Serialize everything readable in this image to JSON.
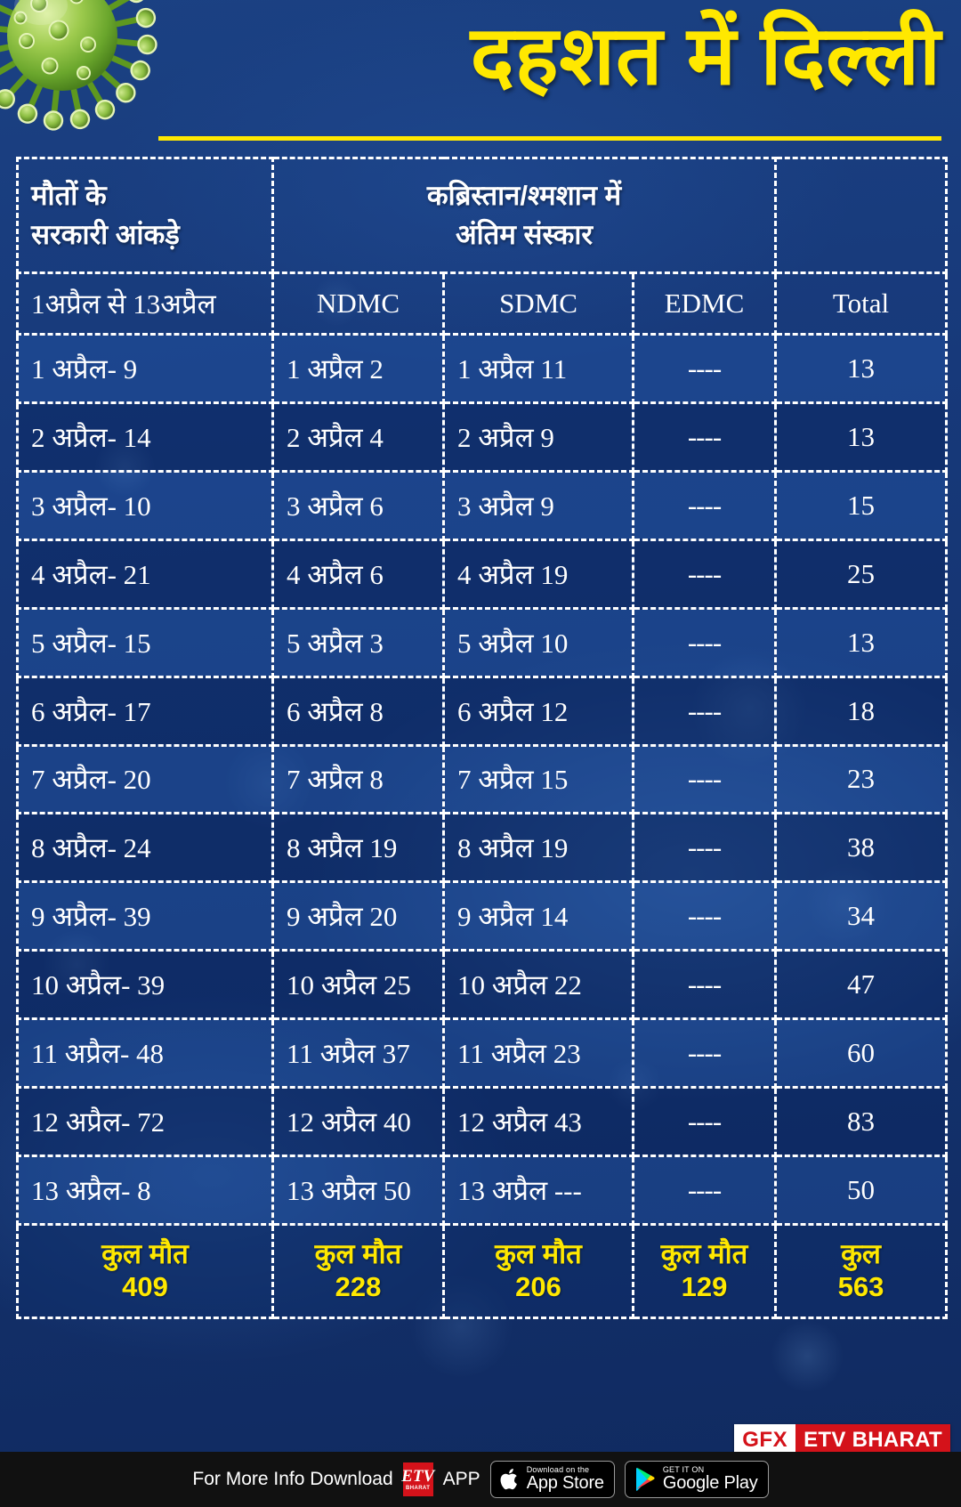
{
  "title": "दहशत में दिल्ली",
  "colors": {
    "accent_yellow": "#ffe800",
    "background_blue": "#16377a",
    "brand_red": "#d4121a",
    "footer_black": "#111111",
    "text_white": "#ffffff"
  },
  "table": {
    "header_groups": [
      {
        "label": "मौतों के\nसरकारी आंकड़े",
        "span": 1
      },
      {
        "label": "कब्रिस्तान/श्मशान में\nअंतिम संस्कार",
        "span": 3
      },
      {
        "label": "",
        "span": 1
      }
    ],
    "header_group_left_line1": "मौतों के",
    "header_group_left_line2": "सरकारी आंकड़े",
    "header_group_mid_line1": "कब्रिस्तान/श्मशान में",
    "header_group_mid_line2": "अंतिम संस्कार",
    "columns": [
      "1अप्रैल से 13अप्रैल",
      "NDMC",
      "SDMC",
      "EDMC",
      "Total"
    ],
    "rows": [
      {
        "govt": "1 अप्रैल- 9",
        "ndmc": "1 अप्रैल 2",
        "sdmc": "1 अप्रैल  11",
        "edmc": "----",
        "total": "13"
      },
      {
        "govt": "2 अप्रैल- 14",
        "ndmc": "2 अप्रैल 4",
        "sdmc": "2 अप्रैल  9",
        "edmc": "----",
        "total": "13"
      },
      {
        "govt": "3 अप्रैल- 10",
        "ndmc": "3 अप्रैल 6",
        "sdmc": "3 अप्रैल  9",
        "edmc": "----",
        "total": "15"
      },
      {
        "govt": "4 अप्रैल- 21",
        "ndmc": "4 अप्रैल 6",
        "sdmc": "4 अप्रैल  19",
        "edmc": "----",
        "total": "25"
      },
      {
        "govt": "5 अप्रैल- 15",
        "ndmc": "5 अप्रैल 3",
        "sdmc": "5 अप्रैल  10",
        "edmc": "----",
        "total": "13"
      },
      {
        "govt": "6 अप्रैल- 17",
        "ndmc": "6 अप्रैल 8",
        "sdmc": "6 अप्रैल  12",
        "edmc": "----",
        "total": "18"
      },
      {
        "govt": "7 अप्रैल- 20",
        "ndmc": "7 अप्रैल 8",
        "sdmc": "7 अप्रैल  15",
        "edmc": "----",
        "total": "23"
      },
      {
        "govt": "8 अप्रैल- 24",
        "ndmc": "8 अप्रैल 19",
        "sdmc": "8 अप्रैल  19",
        "edmc": "----",
        "total": "38"
      },
      {
        "govt": "9 अप्रैल- 39",
        "ndmc": "9 अप्रैल 20",
        "sdmc": "9 अप्रैल  14",
        "edmc": "----",
        "total": "34"
      },
      {
        "govt": "10 अप्रैल- 39",
        "ndmc": "10 अप्रैल 25",
        "sdmc": "10 अप्रैल  22",
        "edmc": "----",
        "total": "47"
      },
      {
        "govt": "11 अप्रैल- 48",
        "ndmc": "11 अप्रैल 37",
        "sdmc": "11 अप्रैल  23",
        "edmc": "----",
        "total": "60"
      },
      {
        "govt": "12 अप्रैल- 72",
        "ndmc": "12 अप्रैल 40",
        "sdmc": "12 अप्रैल  43",
        "edmc": "----",
        "total": "83"
      },
      {
        "govt": "13 अप्रैल- 8",
        "ndmc": "13 अप्रैल 50",
        "sdmc": "13 अप्रैल ---",
        "edmc": "----",
        "total": "50"
      }
    ],
    "totals": {
      "label_deaths": "कुल मौत",
      "label_total": "कुल",
      "govt": "409",
      "ndmc": "228",
      "sdmc": "206",
      "edmc": "129",
      "total": "563"
    }
  },
  "brand": {
    "gfx": "GFX",
    "channel": "ETV BHARAT"
  },
  "footer": {
    "promo_text": "For More Info Download",
    "app_word": "APP",
    "etv_logo_main": "ETV",
    "etv_logo_sub": "BHARAT",
    "appstore_small": "Download on the",
    "appstore_big": "App Store",
    "googleplay_small": "GET IT ON",
    "googleplay_big": "Google Play"
  },
  "chart_data": {
    "type": "table",
    "title": "दहशत में दिल्ली",
    "categories": [
      "1 अप्रैल",
      "2 अप्रैल",
      "3 अप्रैल",
      "4 अप्रैल",
      "5 अप्रैल",
      "6 अप्रैल",
      "7 अप्रैल",
      "8 अप्रैल",
      "9 अप्रैल",
      "10 अप्रैल",
      "11 अप्रैल",
      "12 अप्रैल",
      "13 अप्रैल"
    ],
    "series": [
      {
        "name": "मौतों के सरकारी आंकड़े",
        "values": [
          9,
          14,
          10,
          21,
          15,
          17,
          20,
          24,
          39,
          39,
          48,
          72,
          8
        ],
        "total": 409
      },
      {
        "name": "NDMC",
        "values": [
          2,
          4,
          6,
          6,
          3,
          8,
          8,
          19,
          20,
          25,
          37,
          40,
          50
        ],
        "total": 228
      },
      {
        "name": "SDMC",
        "values": [
          11,
          9,
          9,
          19,
          10,
          12,
          15,
          19,
          14,
          22,
          23,
          43,
          null
        ],
        "total": 206
      },
      {
        "name": "EDMC",
        "values": [
          null,
          null,
          null,
          null,
          null,
          null,
          null,
          null,
          null,
          null,
          null,
          null,
          null
        ],
        "total": 129
      },
      {
        "name": "Total",
        "values": [
          13,
          13,
          15,
          25,
          13,
          18,
          23,
          38,
          34,
          47,
          60,
          83,
          50
        ],
        "total": 563
      }
    ],
    "xlabel": "1अप्रैल से 13अप्रैल",
    "ylabel": "",
    "grid": true,
    "legend": "top"
  }
}
